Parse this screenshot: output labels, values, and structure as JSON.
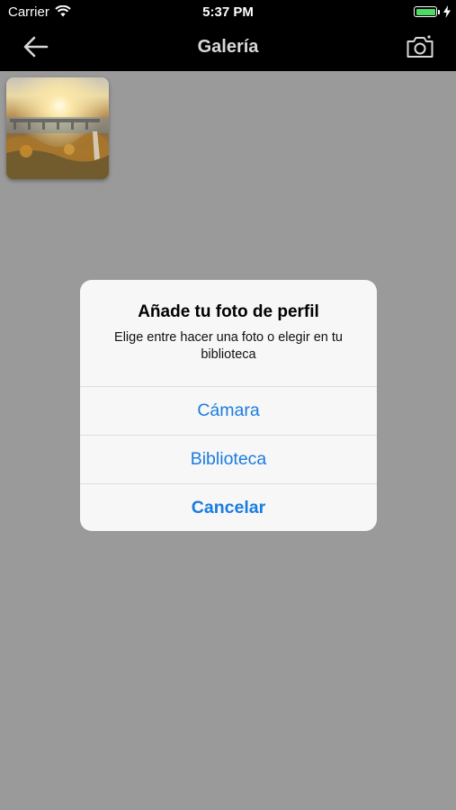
{
  "status_bar": {
    "carrier": "Carrier",
    "time": "5:37 PM",
    "battery_level": 1.0
  },
  "nav": {
    "title": "Galería",
    "back_icon": "arrow-left-icon",
    "camera_icon": "camera-icon"
  },
  "gallery": {
    "items": [
      {
        "type": "photo"
      }
    ]
  },
  "alert": {
    "title": "Añade tu foto de perfil",
    "message": "Elige entre hacer una foto o elegir en tu biblioteca",
    "buttons": {
      "camera": "Cámara",
      "library": "Biblioteca",
      "cancel": "Cancelar"
    }
  },
  "colors": {
    "nav_background": "#000000",
    "overlay": "#9a9a9a",
    "accent": "#1a7ce0",
    "battery": "#4cd964"
  }
}
